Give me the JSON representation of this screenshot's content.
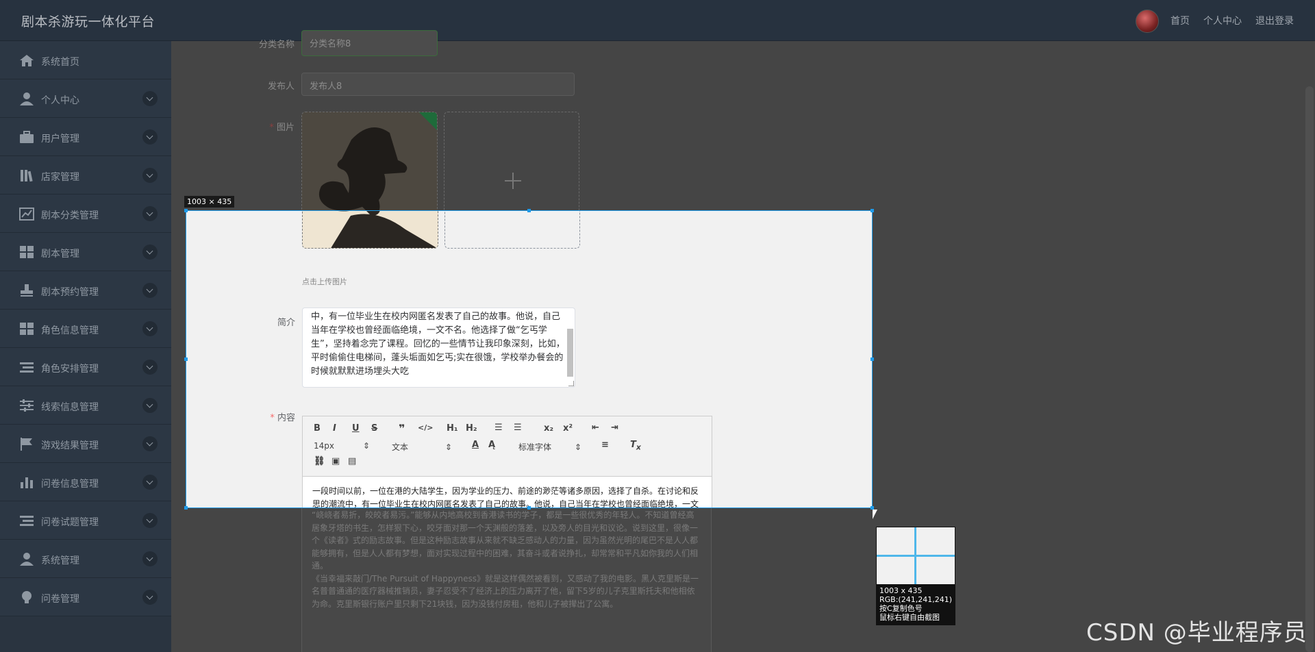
{
  "app": {
    "title": "剧本杀游玩一体化平台"
  },
  "header": {
    "home": "首页",
    "user_center": "个人中心",
    "logout": "退出登录"
  },
  "sidebar": {
    "items": [
      {
        "label": "系统首页",
        "icon": "home-icon",
        "expandable": false
      },
      {
        "label": "个人中心",
        "icon": "user-icon",
        "expandable": true
      },
      {
        "label": "用户管理",
        "icon": "briefcase-icon",
        "expandable": true
      },
      {
        "label": "店家管理",
        "icon": "books-icon",
        "expandable": true
      },
      {
        "label": "剧本分类管理",
        "icon": "trend-chart-icon",
        "expandable": true
      },
      {
        "label": "剧本管理",
        "icon": "grid-icon",
        "expandable": true
      },
      {
        "label": "剧本预约管理",
        "icon": "stamp-icon",
        "expandable": true
      },
      {
        "label": "角色信息管理",
        "icon": "grid-icon",
        "expandable": true
      },
      {
        "label": "角色安排管理",
        "icon": "list-icon",
        "expandable": true
      },
      {
        "label": "线索信息管理",
        "icon": "sliders-icon",
        "expandable": true
      },
      {
        "label": "游戏结果管理",
        "icon": "flag-icon",
        "expandable": true
      },
      {
        "label": "问卷信息管理",
        "icon": "bar-chart-icon",
        "expandable": true
      },
      {
        "label": "问卷试题管理",
        "icon": "list-icon",
        "expandable": true
      },
      {
        "label": "系统管理",
        "icon": "user-icon",
        "expandable": true
      },
      {
        "label": "问卷管理",
        "icon": "bulb-icon",
        "expandable": true
      }
    ]
  },
  "form": {
    "category_label": "分类名称",
    "category_value": "分类名称8",
    "publisher_label": "发布人",
    "publisher_value": "发布人8",
    "image_label": "图片",
    "upload_hint": "点击上传图片",
    "intro_label": "简介",
    "intro_text": "中，有一位毕业生在校内网匿名发表了自己的故事。他说，自己当年在学校也曾经面临绝境，一文不名。他选择了做“乞丐学生”，坚持着念完了课程。回忆的一些情节让我印象深刻，比如，平时偷偷住电梯间，蓬头垢面如乞丐;实在很饿，学校举办餐会的时候就默默进场埋头大吃",
    "content_label": "内容"
  },
  "editor": {
    "font_size": "14px",
    "text_style": "文本",
    "font_family": "标准字体",
    "content": [
      "一段时间以前，一位在港的大陆学生，因为学业的压力、前途的渺茫等诸多原因，选择了自杀。在讨论和反思的潮流中，有一位毕业生在校内网匿名发表了自己的故事。他说，自己当年在学校也曾经面临绝境，一文不名。他选择了做“乞丐学生”，坚持着念完了课程。回忆的一些情节让我印象深刻，比如，平时偷偷住电梯间，蓬头垢面如乞丐;实在很饿，学校举办餐会的时候就默默进场埋头大吃。",
      "“峣峣者易折，皎皎者易污。”能够从内地高校到香港读书的学子，都是一些很优秀的年轻人。不知道曾经高居象牙塔的书生，怎样狠下心，咬牙面对那一个天渊般的落差，以及旁人的目光和议论。说到这里，很像一个《读者》式的励志故事。但是这种励志故事从来就不缺乏感动人的力量，因为虽然光明的尾巴不是人人都能够拥有，但是人人都有梦想，面对实现过程中的困难，其奋斗或者说挣扎，却常常和平凡如你我的人们相通。",
      "《当幸福来敲门/The Pursuit of Happyness》就是这样偶然被看到，又感动了我的电影。黑人克里斯是一名普普通通的医疗器械推销员，妻子忍受不了经济上的压力离开了他，留下5岁的儿子克里斯托夫和他相依为命。克里斯银行账户里只剩下21块钱，因为没钱付房租，他和儿子被撵出了公寓。"
    ]
  },
  "capture": {
    "size_label": "1003 × 435",
    "mag_size": "1003 x 435",
    "mag_rgb": "RGB:(241,241,241)",
    "mag_copy": "按C复制色号",
    "mag_hint": "鼠标右键自由截图"
  },
  "watermark": "CSDN @毕业程序员"
}
